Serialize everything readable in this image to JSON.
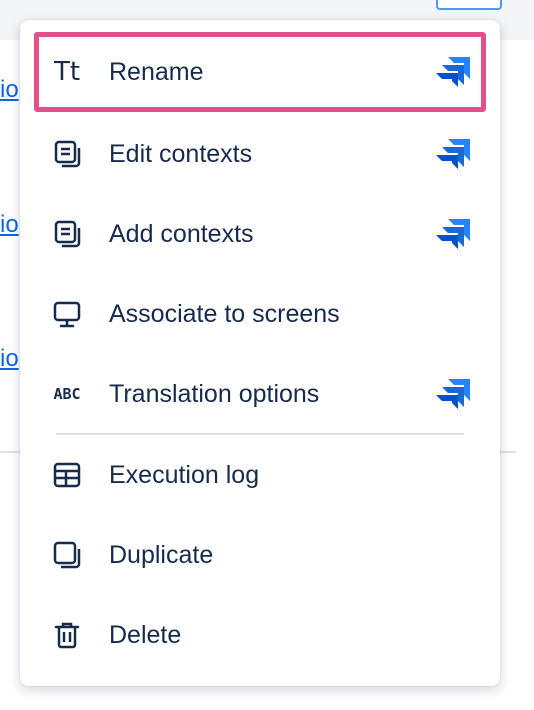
{
  "background": {
    "link_fragment": "io"
  },
  "menu": {
    "items": [
      {
        "label": "Rename",
        "icon": "text-style-icon",
        "badge": "jira-software-icon",
        "highlighted": true
      },
      {
        "label": "Edit contexts",
        "icon": "copy-document-icon",
        "badge": "jira-software-icon"
      },
      {
        "label": "Add contexts",
        "icon": "copy-document-icon",
        "badge": "jira-software-icon"
      },
      {
        "label": "Associate to screens",
        "icon": "monitor-icon"
      },
      {
        "label": "Translation options",
        "icon": "abc-icon",
        "badge": "jira-software-icon"
      },
      {
        "label": "Execution log",
        "icon": "table-icon"
      },
      {
        "label": "Duplicate",
        "icon": "duplicate-icon"
      },
      {
        "label": "Delete",
        "icon": "trash-icon"
      }
    ],
    "tt_glyph": "Tt",
    "abc_glyph": "ABC"
  },
  "colors": {
    "highlight_border": "#e2508a",
    "text": "#172b4d",
    "jira_blue_dark": "#2684ff",
    "jira_blue_light": "#0052cc"
  }
}
